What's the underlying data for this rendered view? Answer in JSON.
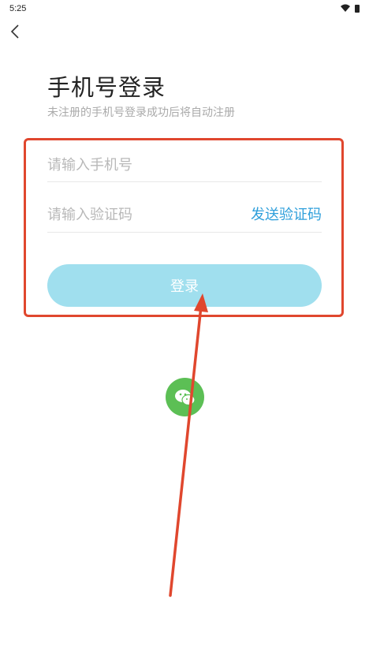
{
  "status_bar": {
    "time": "5:25"
  },
  "icons": {
    "back": "chevron-left-icon",
    "wifi": "wifi-icon",
    "battery": "battery-icon",
    "wechat": "wechat-icon"
  },
  "login": {
    "title": "手机号登录",
    "subtitle": "未注册的手机号登录成功后将自动注册",
    "phone_placeholder": "请输入手机号",
    "code_placeholder": "请输入验证码",
    "send_code": "发送验证码",
    "submit": "登录"
  },
  "colors": {
    "accent": "#2e9fdb",
    "button": "#a0dfee",
    "annotation": "#e0472e",
    "wechat": "#5cbf55"
  }
}
